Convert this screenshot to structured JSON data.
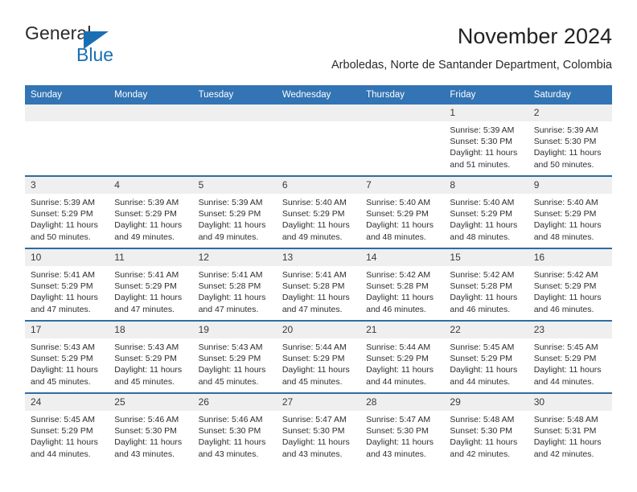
{
  "logo": {
    "word1": "General",
    "word2": "Blue",
    "triangle_color": "#1a6fb4"
  },
  "header": {
    "title": "November 2024",
    "subtitle": "Arboledas, Norte de Santander Department, Colombia"
  },
  "colors": {
    "header_blue": "#3274b4",
    "row_divider_blue": "#2d6da4",
    "daynum_bg": "#efefef"
  },
  "calendar": {
    "weekday_headers": [
      "Sunday",
      "Monday",
      "Tuesday",
      "Wednesday",
      "Thursday",
      "Friday",
      "Saturday"
    ],
    "weeks": [
      [
        {
          "day": "",
          "empty": true,
          "sunrise": "",
          "sunset": "",
          "daylight1": "",
          "daylight2": ""
        },
        {
          "day": "",
          "empty": true,
          "sunrise": "",
          "sunset": "",
          "daylight1": "",
          "daylight2": ""
        },
        {
          "day": "",
          "empty": true,
          "sunrise": "",
          "sunset": "",
          "daylight1": "",
          "daylight2": ""
        },
        {
          "day": "",
          "empty": true,
          "sunrise": "",
          "sunset": "",
          "daylight1": "",
          "daylight2": ""
        },
        {
          "day": "",
          "empty": true,
          "sunrise": "",
          "sunset": "",
          "daylight1": "",
          "daylight2": ""
        },
        {
          "day": "1",
          "sunrise": "Sunrise: 5:39 AM",
          "sunset": "Sunset: 5:30 PM",
          "daylight1": "Daylight: 11 hours",
          "daylight2": "and 51 minutes."
        },
        {
          "day": "2",
          "sunrise": "Sunrise: 5:39 AM",
          "sunset": "Sunset: 5:30 PM",
          "daylight1": "Daylight: 11 hours",
          "daylight2": "and 50 minutes."
        }
      ],
      [
        {
          "day": "3",
          "sunrise": "Sunrise: 5:39 AM",
          "sunset": "Sunset: 5:29 PM",
          "daylight1": "Daylight: 11 hours",
          "daylight2": "and 50 minutes."
        },
        {
          "day": "4",
          "sunrise": "Sunrise: 5:39 AM",
          "sunset": "Sunset: 5:29 PM",
          "daylight1": "Daylight: 11 hours",
          "daylight2": "and 49 minutes."
        },
        {
          "day": "5",
          "sunrise": "Sunrise: 5:39 AM",
          "sunset": "Sunset: 5:29 PM",
          "daylight1": "Daylight: 11 hours",
          "daylight2": "and 49 minutes."
        },
        {
          "day": "6",
          "sunrise": "Sunrise: 5:40 AM",
          "sunset": "Sunset: 5:29 PM",
          "daylight1": "Daylight: 11 hours",
          "daylight2": "and 49 minutes."
        },
        {
          "day": "7",
          "sunrise": "Sunrise: 5:40 AM",
          "sunset": "Sunset: 5:29 PM",
          "daylight1": "Daylight: 11 hours",
          "daylight2": "and 48 minutes."
        },
        {
          "day": "8",
          "sunrise": "Sunrise: 5:40 AM",
          "sunset": "Sunset: 5:29 PM",
          "daylight1": "Daylight: 11 hours",
          "daylight2": "and 48 minutes."
        },
        {
          "day": "9",
          "sunrise": "Sunrise: 5:40 AM",
          "sunset": "Sunset: 5:29 PM",
          "daylight1": "Daylight: 11 hours",
          "daylight2": "and 48 minutes."
        }
      ],
      [
        {
          "day": "10",
          "sunrise": "Sunrise: 5:41 AM",
          "sunset": "Sunset: 5:29 PM",
          "daylight1": "Daylight: 11 hours",
          "daylight2": "and 47 minutes."
        },
        {
          "day": "11",
          "sunrise": "Sunrise: 5:41 AM",
          "sunset": "Sunset: 5:29 PM",
          "daylight1": "Daylight: 11 hours",
          "daylight2": "and 47 minutes."
        },
        {
          "day": "12",
          "sunrise": "Sunrise: 5:41 AM",
          "sunset": "Sunset: 5:28 PM",
          "daylight1": "Daylight: 11 hours",
          "daylight2": "and 47 minutes."
        },
        {
          "day": "13",
          "sunrise": "Sunrise: 5:41 AM",
          "sunset": "Sunset: 5:28 PM",
          "daylight1": "Daylight: 11 hours",
          "daylight2": "and 47 minutes."
        },
        {
          "day": "14",
          "sunrise": "Sunrise: 5:42 AM",
          "sunset": "Sunset: 5:28 PM",
          "daylight1": "Daylight: 11 hours",
          "daylight2": "and 46 minutes."
        },
        {
          "day": "15",
          "sunrise": "Sunrise: 5:42 AM",
          "sunset": "Sunset: 5:28 PM",
          "daylight1": "Daylight: 11 hours",
          "daylight2": "and 46 minutes."
        },
        {
          "day": "16",
          "sunrise": "Sunrise: 5:42 AM",
          "sunset": "Sunset: 5:29 PM",
          "daylight1": "Daylight: 11 hours",
          "daylight2": "and 46 minutes."
        }
      ],
      [
        {
          "day": "17",
          "sunrise": "Sunrise: 5:43 AM",
          "sunset": "Sunset: 5:29 PM",
          "daylight1": "Daylight: 11 hours",
          "daylight2": "and 45 minutes."
        },
        {
          "day": "18",
          "sunrise": "Sunrise: 5:43 AM",
          "sunset": "Sunset: 5:29 PM",
          "daylight1": "Daylight: 11 hours",
          "daylight2": "and 45 minutes."
        },
        {
          "day": "19",
          "sunrise": "Sunrise: 5:43 AM",
          "sunset": "Sunset: 5:29 PM",
          "daylight1": "Daylight: 11 hours",
          "daylight2": "and 45 minutes."
        },
        {
          "day": "20",
          "sunrise": "Sunrise: 5:44 AM",
          "sunset": "Sunset: 5:29 PM",
          "daylight1": "Daylight: 11 hours",
          "daylight2": "and 45 minutes."
        },
        {
          "day": "21",
          "sunrise": "Sunrise: 5:44 AM",
          "sunset": "Sunset: 5:29 PM",
          "daylight1": "Daylight: 11 hours",
          "daylight2": "and 44 minutes."
        },
        {
          "day": "22",
          "sunrise": "Sunrise: 5:45 AM",
          "sunset": "Sunset: 5:29 PM",
          "daylight1": "Daylight: 11 hours",
          "daylight2": "and 44 minutes."
        },
        {
          "day": "23",
          "sunrise": "Sunrise: 5:45 AM",
          "sunset": "Sunset: 5:29 PM",
          "daylight1": "Daylight: 11 hours",
          "daylight2": "and 44 minutes."
        }
      ],
      [
        {
          "day": "24",
          "sunrise": "Sunrise: 5:45 AM",
          "sunset": "Sunset: 5:29 PM",
          "daylight1": "Daylight: 11 hours",
          "daylight2": "and 44 minutes."
        },
        {
          "day": "25",
          "sunrise": "Sunrise: 5:46 AM",
          "sunset": "Sunset: 5:30 PM",
          "daylight1": "Daylight: 11 hours",
          "daylight2": "and 43 minutes."
        },
        {
          "day": "26",
          "sunrise": "Sunrise: 5:46 AM",
          "sunset": "Sunset: 5:30 PM",
          "daylight1": "Daylight: 11 hours",
          "daylight2": "and 43 minutes."
        },
        {
          "day": "27",
          "sunrise": "Sunrise: 5:47 AM",
          "sunset": "Sunset: 5:30 PM",
          "daylight1": "Daylight: 11 hours",
          "daylight2": "and 43 minutes."
        },
        {
          "day": "28",
          "sunrise": "Sunrise: 5:47 AM",
          "sunset": "Sunset: 5:30 PM",
          "daylight1": "Daylight: 11 hours",
          "daylight2": "and 43 minutes."
        },
        {
          "day": "29",
          "sunrise": "Sunrise: 5:48 AM",
          "sunset": "Sunset: 5:30 PM",
          "daylight1": "Daylight: 11 hours",
          "daylight2": "and 42 minutes."
        },
        {
          "day": "30",
          "sunrise": "Sunrise: 5:48 AM",
          "sunset": "Sunset: 5:31 PM",
          "daylight1": "Daylight: 11 hours",
          "daylight2": "and 42 minutes."
        }
      ]
    ]
  }
}
